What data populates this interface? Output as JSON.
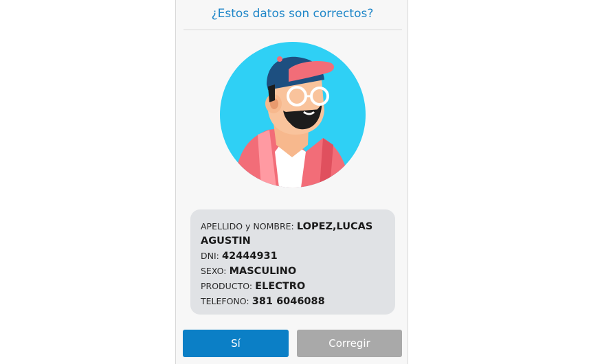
{
  "dialog": {
    "title": "¿Estos datos son correctos?",
    "avatar_icon": "user-avatar-illustration",
    "fields": [
      {
        "label": "APELLIDO y NOMBRE:",
        "value": "LOPEZ,LUCAS AGUSTIN"
      },
      {
        "label": "DNI:",
        "value": "42444931"
      },
      {
        "label": "SEXO:",
        "value": "MASCULINO"
      },
      {
        "label": "PRODUCTO:",
        "value": "ELECTRO"
      },
      {
        "label": "TELEFONO:",
        "value": "381 6046088"
      }
    ],
    "buttons": {
      "confirm_label": "Sí",
      "correct_label": "Corregir"
    }
  },
  "colors": {
    "accent": "#0b7fc6",
    "title": "#1e86c8",
    "secondary_button": "#a9a9a9",
    "card": "#e0e2e5",
    "avatar_bg": "#2fd0f5"
  }
}
